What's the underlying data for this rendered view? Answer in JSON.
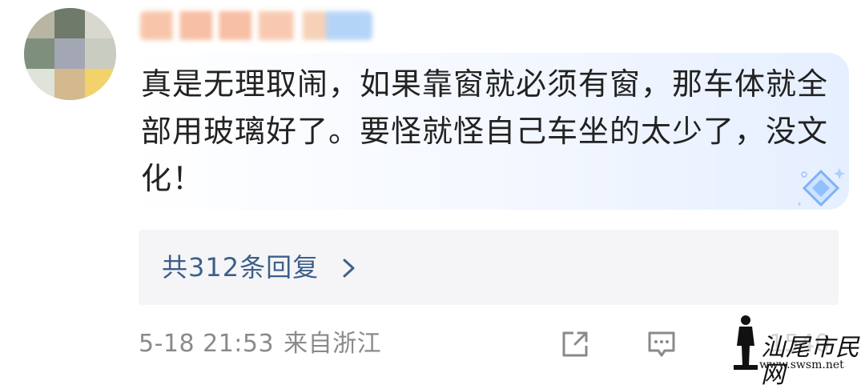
{
  "comment": {
    "text": "真是无理取闹，如果靠窗就必须有窗，那车体就全部用玻璃好了。要怪就怪自己车坐的太少了，没文化！"
  },
  "replies": {
    "label": "共312条回复"
  },
  "meta": {
    "time": "5-18 21:53",
    "location": "来自浙江",
    "like_count": "1540"
  },
  "watermark": {
    "site_name": "汕尾市民网",
    "url": "www.swsm.net"
  },
  "icons": {
    "share": "share-icon",
    "comment": "comment-icon",
    "like": "like-icon",
    "chevron": "chevron-right-icon",
    "badge": "diamond-icon"
  },
  "colors": {
    "reply_link": "#3d5f8a",
    "meta": "#8a8a8a",
    "text": "#222222"
  }
}
